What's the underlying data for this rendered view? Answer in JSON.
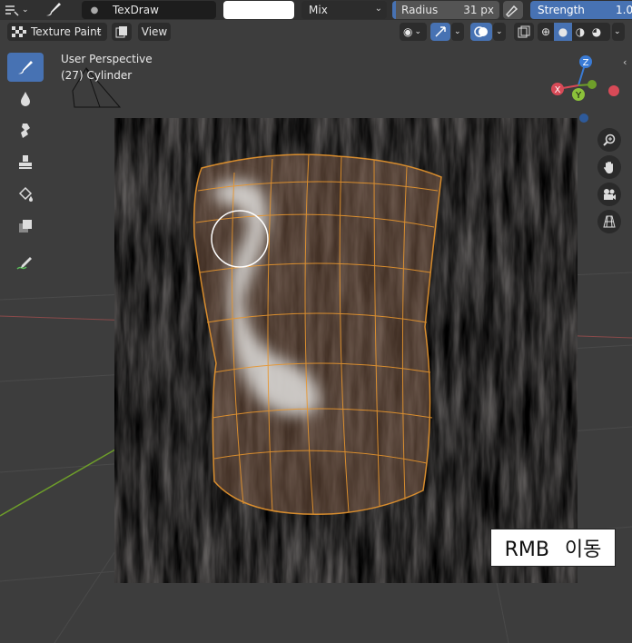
{
  "header": {
    "brush_name": "TexDraw",
    "blend_mode": "Mix",
    "radius_label": "Radius",
    "radius_value": "31 px",
    "strength_label": "Strength",
    "strength_value": "1.0"
  },
  "header2": {
    "mode": "Texture Paint",
    "view_label": "View"
  },
  "viewport": {
    "perspective_label": "User Perspective",
    "object_label": "(27) Cylinder"
  },
  "gizmo": {
    "z_label": "Z",
    "y_label": "Y",
    "x_label": "X"
  },
  "caption": {
    "text": "RMB  이동"
  },
  "colors": {
    "accent": "#4772b3",
    "wire": "#e8962e",
    "axis_x": "#d84a57",
    "axis_y": "#6e9e2a",
    "axis_z": "#3a7bd5"
  },
  "tools": [
    "draw-brush-icon",
    "soften-brush-icon",
    "smear-brush-icon",
    "clone-brush-icon",
    "fill-brush-icon",
    "mask-brush-icon",
    "annotate-icon"
  ]
}
